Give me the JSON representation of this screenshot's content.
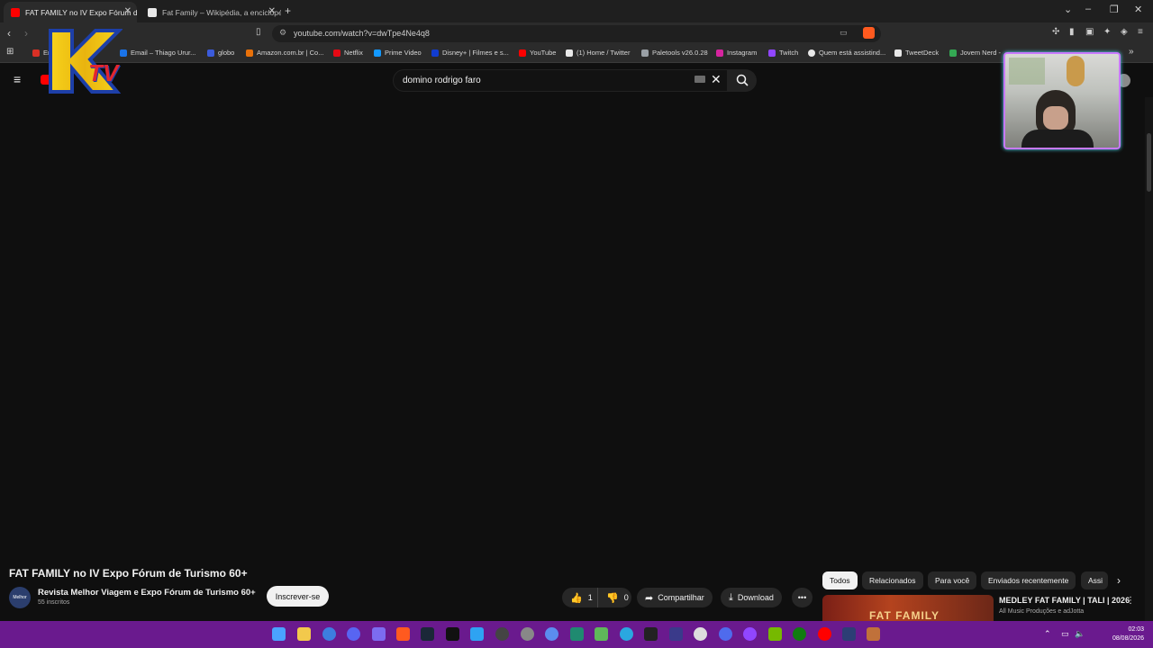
{
  "browser": {
    "tabs": [
      {
        "title": "FAT FAMILY no IV Expo Fórum de",
        "active": true
      },
      {
        "title": "Fat Family – Wikipédia, a enciclopédi",
        "active": false
      }
    ],
    "new_tab": "+",
    "url": "youtube.com/watch?v=dwTpe4Ne4q8",
    "bookmarks": [
      {
        "label": "Em",
        "color": "#d93025"
      },
      {
        "label": "Email – Thiago Urur...",
        "color": "#1a73e8"
      },
      {
        "label": "globo",
        "color": "#3b5bdb"
      },
      {
        "label": "Amazon.com.br | Co...",
        "color": "#e8710a"
      },
      {
        "label": "Netflix",
        "color": "#e50914"
      },
      {
        "label": "Prime Video",
        "color": "#1399ff"
      },
      {
        "label": "Disney+ | Filmes e s...",
        "color": "#113ccf"
      },
      {
        "label": "YouTube",
        "color": "#ff0000"
      },
      {
        "label": "(1) Home / Twitter",
        "color": "#e8e8e8"
      },
      {
        "label": "Paletools v26.0.28",
        "color": "#9aa0a6"
      },
      {
        "label": "Instagram",
        "color": "#d6249f"
      },
      {
        "label": "Twitch",
        "color": "#9146ff"
      },
      {
        "label": "Quem está assistind...",
        "color": "#e8e8e8"
      },
      {
        "label": "TweetDeck",
        "color": "#e8e8e8"
      },
      {
        "label": "Jovem Nerd -",
        "color": "#34a853"
      }
    ]
  },
  "youtube": {
    "search_value": "domino rodrigo faro",
    "video_title": "FAT FAMILY no IV Expo Fórum de Turismo 60+",
    "channel_name": "Revista Melhor Viagem e Expo Fórum de Turismo 60+",
    "channel_avatar_text": "Melhor",
    "subscribers": "55 inscritos",
    "subscribe_label": "Inscrever-se",
    "likes": "1",
    "dislikes": "0",
    "share_label": "Compartilhar",
    "download_label": "Download",
    "chips": [
      "Todos",
      "Relacionados",
      "Para você",
      "Enviados recentemente",
      "Assi"
    ],
    "recommendation": {
      "title": "MEDLEY FAT FAMILY | TALI | 2026",
      "channel": "All Music Produções e adJotta",
      "thumb_text": "FAT FAMILY"
    }
  },
  "overlay": {
    "logo_letter": "K",
    "logo_tv": "TV"
  },
  "taskbar": {
    "time": "02:03",
    "date": "08/08/2026"
  },
  "colors": {
    "taskbar": "#6a1a8e",
    "youtube_red": "#ff0000",
    "webcam_border": "#c879ff"
  }
}
